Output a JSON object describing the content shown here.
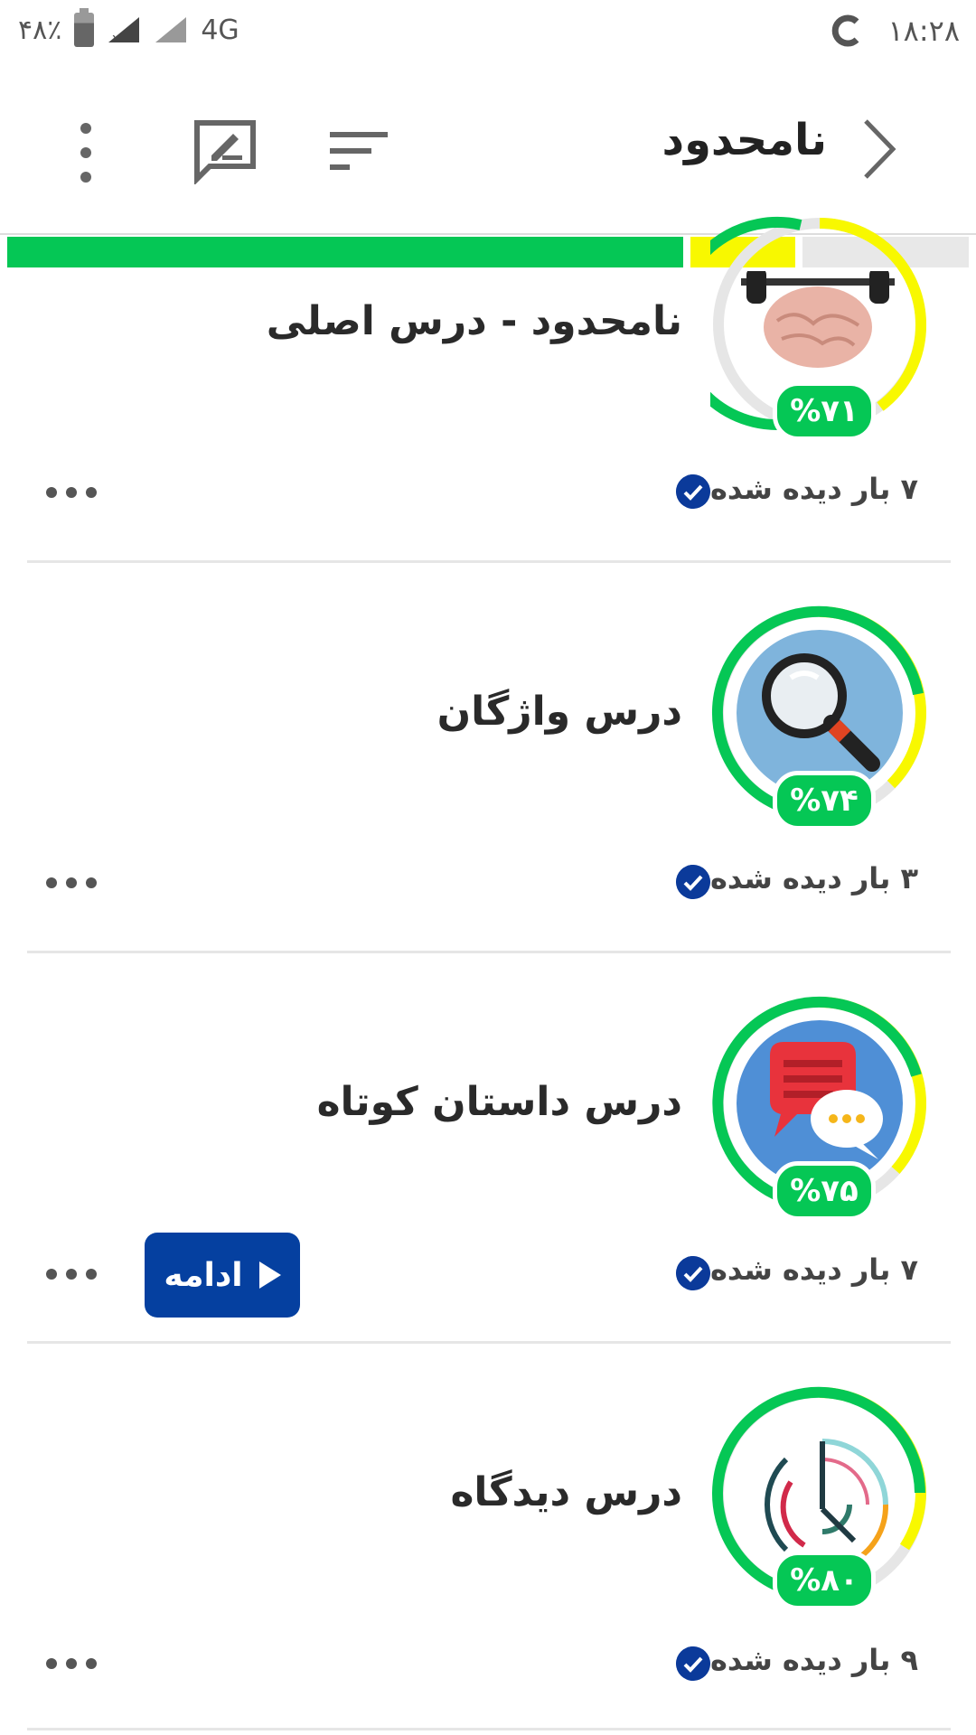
{
  "status_bar": {
    "battery_percent": "۴۸٪",
    "network": "4G",
    "time": "۱۸:۲۸"
  },
  "app_bar": {
    "title": "نامحدود"
  },
  "overall_progress": {
    "green_fraction": 0.7,
    "yellow_fraction": 0.11,
    "colors": {
      "green": "#05c755",
      "yellow": "#f8f800",
      "grey": "#e8e8e8"
    }
  },
  "lessons": [
    {
      "title": "نامحدود - درس اصلی",
      "percent": "%۷۱",
      "progress": 0.71,
      "views": "۷ بار دیده شده",
      "icon": "brain-dumbbell-icon"
    },
    {
      "title": "درس واژگان",
      "percent": "%۷۴",
      "progress": 0.74,
      "views": "۳ بار دیده شده",
      "icon": "magnifier-icon"
    },
    {
      "title": "درس داستان کوتاه",
      "percent": "%۷۵",
      "progress": 0.75,
      "views": "۷ بار دیده شده",
      "icon": "chat-bubbles-icon",
      "resume_label": "ادامه"
    },
    {
      "title": "درس دیدگاه",
      "percent": "%۸۰",
      "progress": 0.8,
      "views": "۹ بار دیده شده",
      "icon": "clock-icon"
    }
  ]
}
